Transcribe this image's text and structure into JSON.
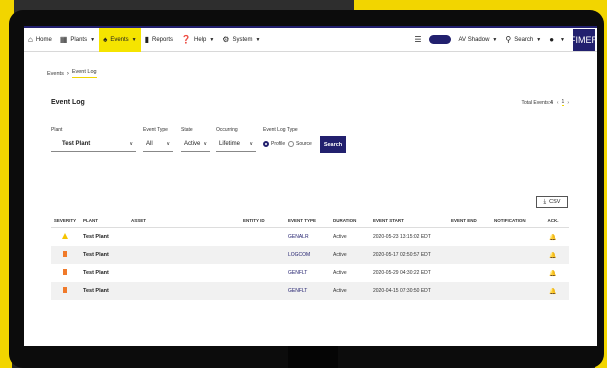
{
  "nav": {
    "items": [
      {
        "icon": "home-icon",
        "glyph": "⌂",
        "label": "Home",
        "caret": false,
        "active": false
      },
      {
        "icon": "plants-icon",
        "glyph": "▦",
        "label": "Plants",
        "caret": true,
        "active": false
      },
      {
        "icon": "events-icon",
        "glyph": "♠",
        "label": "Events",
        "caret": true,
        "active": true
      },
      {
        "icon": "reports-icon",
        "glyph": "▮",
        "label": "Reports",
        "caret": false,
        "active": false
      },
      {
        "icon": "help-icon",
        "glyph": "❓",
        "label": "Help",
        "caret": true,
        "active": false
      },
      {
        "icon": "system-icon",
        "glyph": "⚙",
        "label": "System",
        "caret": true,
        "active": false
      }
    ],
    "user_label": "AV Shadow",
    "search_label": "Search",
    "brand": "FIMER",
    "accent_color": "#22206e",
    "highlight_color": "#f5e400"
  },
  "breadcrumb": {
    "root": "Events",
    "current": "Event Log"
  },
  "page": {
    "title": "Event Log",
    "total_label": "Total Events:",
    "total_value": "4",
    "page_current": "1"
  },
  "filters": {
    "plant_label": "Plant",
    "plant_value": "Test Plant",
    "event_type_label": "Event Type",
    "event_type_value": "All",
    "state_label": "State",
    "state_value": "Active",
    "occurring_label": "Occurring",
    "occurring_value": "Lifetime",
    "log_type_label": "Event Log Type",
    "log_type_options": [
      "Profile",
      "Source"
    ],
    "log_type_selected": "Profile",
    "search_label": "Search"
  },
  "csv_label": "CSV",
  "table": {
    "headers": [
      "SEVERITY",
      "PLANT",
      "ASSET",
      "ENTITY ID",
      "EVENT TYPE",
      "DURATION",
      "EVENT START",
      "EVENT END",
      "NOTIFICATION",
      "ACK."
    ],
    "rows": [
      {
        "severity": "warning",
        "plant": "Test Plant",
        "asset": "",
        "entity_id": "",
        "event_type": "GENALR",
        "duration": "Active",
        "event_start": "2020-05-23 13:15:02 EDT",
        "event_end": "",
        "notification": ""
      },
      {
        "severity": "fault",
        "plant": "Test Plant",
        "asset": "",
        "entity_id": "",
        "event_type": "LOGCOM",
        "duration": "Active",
        "event_start": "2020-05-17 02:50:57 EDT",
        "event_end": "",
        "notification": ""
      },
      {
        "severity": "fault",
        "plant": "Test Plant",
        "asset": "",
        "entity_id": "",
        "event_type": "GENFLT",
        "duration": "Active",
        "event_start": "2020-05-29 04:30:22 EDT",
        "event_end": "",
        "notification": ""
      },
      {
        "severity": "fault",
        "plant": "Test Plant",
        "asset": "",
        "entity_id": "",
        "event_type": "GENFLT",
        "duration": "Active",
        "event_start": "2020-04-15 07:30:50 EDT",
        "event_end": "",
        "notification": ""
      }
    ]
  }
}
